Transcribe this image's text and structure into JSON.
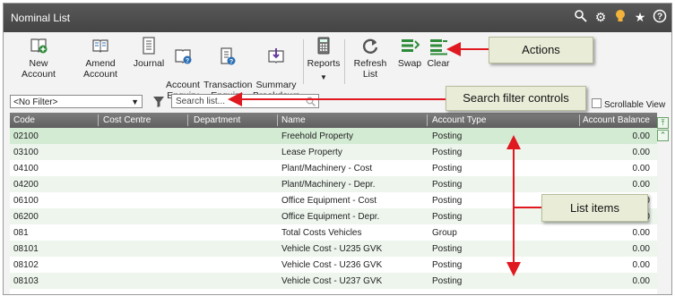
{
  "window": {
    "title": "Nominal List"
  },
  "titlebar_icons": [
    "search-settings-icon",
    "gear-icon",
    "lightbulb-icon",
    "star-icon",
    "help-icon"
  ],
  "toolbar": {
    "buttons": [
      {
        "label": "New Account",
        "icon": "book-plus-icon"
      },
      {
        "label": "Amend Account",
        "icon": "book-open-icon"
      },
      {
        "label": "Journal",
        "icon": "document-icon"
      },
      {
        "label": "Account\nEnquiry",
        "icon": "book-question-icon"
      },
      {
        "label": "Transaction\nEnquiry",
        "icon": "document-question-icon"
      },
      {
        "label": "Summary\nBreakdown",
        "icon": "book-download-icon"
      },
      {
        "label": "Reports",
        "icon": "calculator-icon"
      },
      {
        "label": "Refresh List",
        "icon": "refresh-icon"
      },
      {
        "label": "Swap",
        "icon": "swap-icon"
      },
      {
        "label": "Clear",
        "icon": "clear-icon"
      }
    ]
  },
  "filter": {
    "selected": "<No Filter>",
    "search_placeholder": "Search list...",
    "scrollable_view_label": "Scrollable View"
  },
  "table": {
    "columns": [
      "Code",
      "Cost Centre",
      "Department",
      "Name",
      "Account Type",
      "Account Balance"
    ],
    "rows": [
      {
        "code": "02100",
        "cost_centre": "",
        "department": "",
        "name": "Freehold Property",
        "type": "Posting",
        "balance": "0.00"
      },
      {
        "code": "03100",
        "cost_centre": "",
        "department": "",
        "name": "Lease Property",
        "type": "Posting",
        "balance": "0.00"
      },
      {
        "code": "04100",
        "cost_centre": "",
        "department": "",
        "name": "Plant/Machinery - Cost",
        "type": "Posting",
        "balance": "0.00"
      },
      {
        "code": "04200",
        "cost_centre": "",
        "department": "",
        "name": "Plant/Machinery - Depr.",
        "type": "Posting",
        "balance": "0.00"
      },
      {
        "code": "06100",
        "cost_centre": "",
        "department": "",
        "name": "Office Equipment - Cost",
        "type": "Posting",
        "balance": "0.00"
      },
      {
        "code": "06200",
        "cost_centre": "",
        "department": "",
        "name": "Office Equipment - Depr.",
        "type": "Posting",
        "balance": "0.00"
      },
      {
        "code": "081",
        "cost_centre": "",
        "department": "",
        "name": "Total Costs Vehicles",
        "type": "Group",
        "balance": "0.00"
      },
      {
        "code": "08101",
        "cost_centre": "",
        "department": "",
        "name": "Vehicle Cost - U235 GVK",
        "type": "Posting",
        "balance": "0.00"
      },
      {
        "code": "08102",
        "cost_centre": "",
        "department": "",
        "name": "Vehicle Cost - U236 GVK",
        "type": "Posting",
        "balance": "0.00"
      },
      {
        "code": "08103",
        "cost_centre": "",
        "department": "",
        "name": "Vehicle Cost - U237 GVK",
        "type": "Posting",
        "balance": "0.00"
      }
    ]
  },
  "callouts": {
    "actions": "Actions",
    "search": "Search filter controls",
    "list": "List items"
  },
  "colors": {
    "selected_row": "#d3ead3",
    "alt_row": "#edf5ed",
    "arrow": "#e0181f",
    "accent_green": "#2e8b3a"
  }
}
